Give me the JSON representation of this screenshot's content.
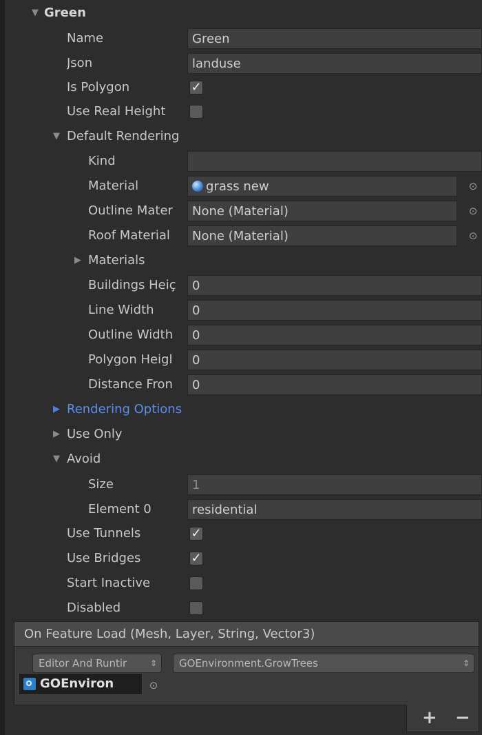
{
  "green": {
    "header": "Green"
  },
  "fields": {
    "name_label": "Name",
    "name_value": "Green",
    "json_label": "Json",
    "json_value": "landuse",
    "is_polygon_label": "Is Polygon",
    "is_polygon_checked": true,
    "use_real_height_label": "Use Real Height",
    "use_real_height_checked": false
  },
  "default_rendering": {
    "label": "Default Rendering",
    "kind_label": "Kind",
    "kind_value": "",
    "material_label": "Material",
    "material_value": "grass new",
    "outline_material_label": "Outline Mater",
    "outline_material_value": "None (Material)",
    "roof_material_label": "Roof Material",
    "roof_material_value": "None (Material)",
    "materials_label": "Materials",
    "buildings_height_label": "Buildings Heiç",
    "buildings_height_value": "0",
    "line_width_label": "Line Width",
    "line_width_value": "0",
    "outline_width_label": "Outline Width",
    "outline_width_value": "0",
    "polygon_height_label": "Polygon Heigl",
    "polygon_height_value": "0",
    "distance_from_label": "Distance Fron",
    "distance_from_value": "0"
  },
  "sections": {
    "rendering_options": "Rendering Options",
    "use_only": "Use Only",
    "avoid": "Avoid"
  },
  "avoid": {
    "size_label": "Size",
    "size_value": "1",
    "element0_label": "Element 0",
    "element0_value": "residential"
  },
  "flags": {
    "use_tunnels_label": "Use Tunnels",
    "use_tunnels_checked": true,
    "use_bridges_label": "Use Bridges",
    "use_bridges_checked": true,
    "start_inactive_label": "Start Inactive",
    "start_inactive_checked": false,
    "disabled_label": "Disabled",
    "disabled_checked": false
  },
  "event": {
    "header": "On Feature Load (Mesh, Layer, String, Vector3)",
    "mode_value": "Editor And Runtir",
    "function_value": "GOEnvironment.GrowTrees",
    "object_value": "GOEnviron",
    "add_label": "+",
    "remove_label": "−"
  },
  "icons": {
    "expanded": "triangle-down-icon",
    "collapsed": "triangle-right-icon",
    "check": "checkmark-icon",
    "object_picker": "object-picker-icon",
    "material": "material-sphere-icon",
    "script": "script-icon"
  },
  "colors": {
    "background": "#2d2d2d",
    "field": "#3f3f3f",
    "accent_blue": "#5c8cec"
  }
}
